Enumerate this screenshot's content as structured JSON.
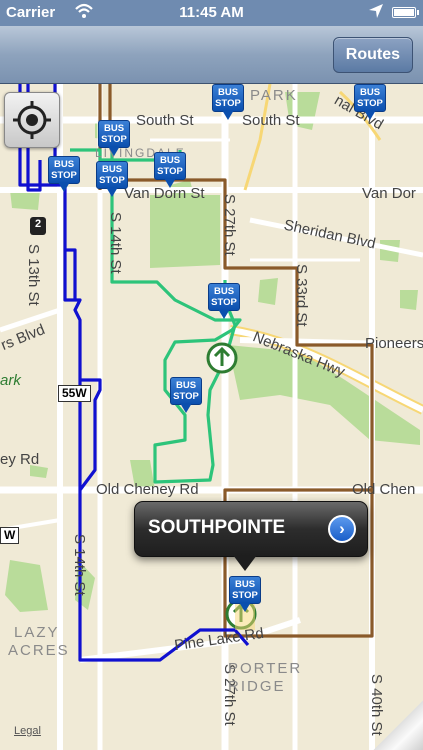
{
  "status_bar": {
    "carrier": "Carrier",
    "time": "11:45 AM"
  },
  "nav": {
    "routes_label": "Routes"
  },
  "map": {
    "labels": {
      "south_st_1": "South St",
      "south_st_2": "South St",
      "van_dorn_1": "Van Dorn St",
      "van_dorn_2": "Van Dor",
      "sheridan": "Sheridan Blvd",
      "pioneers": "Pioneers",
      "nebraska_hwy": "Nebraska Hwy",
      "old_cheney_1": "Old Cheney Rd",
      "old_cheney_2": "Old Chen",
      "old_cheney_3": "ey Rd",
      "pine_lake": "Pine Lake Rd",
      "s13th": "S 13th St",
      "s14th_top": "S 14th St",
      "s14th_bottom": "S 14th St",
      "s27th_top": "S 27th St",
      "s27th_bottom": "S 27th St",
      "s33rd": "S 33rd St",
      "s40th": "S 40th St",
      "rs_blvd": "rs Blvd",
      "park_top": "PARK",
      "livingdale": "LIVINGDALE",
      "ark": "ark",
      "nal_blvd": "nal Blvd",
      "lazy_acres_1": "LAZY",
      "lazy_acres_2": "ACRES",
      "porter_ridge_1": "PORTER",
      "porter_ridge_2": "RIDGE",
      "hwy_55w": "55W",
      "hwy_w": "W",
      "shield_2": "2"
    },
    "bus_stop_label": [
      "BUS",
      "STOP"
    ],
    "route_colors": {
      "blue": "#1010d0",
      "green": "#2dc47a",
      "brown": "#8a5a2a"
    }
  },
  "callout": {
    "title": "SOUTHPOINTE"
  },
  "legal": "Legal"
}
